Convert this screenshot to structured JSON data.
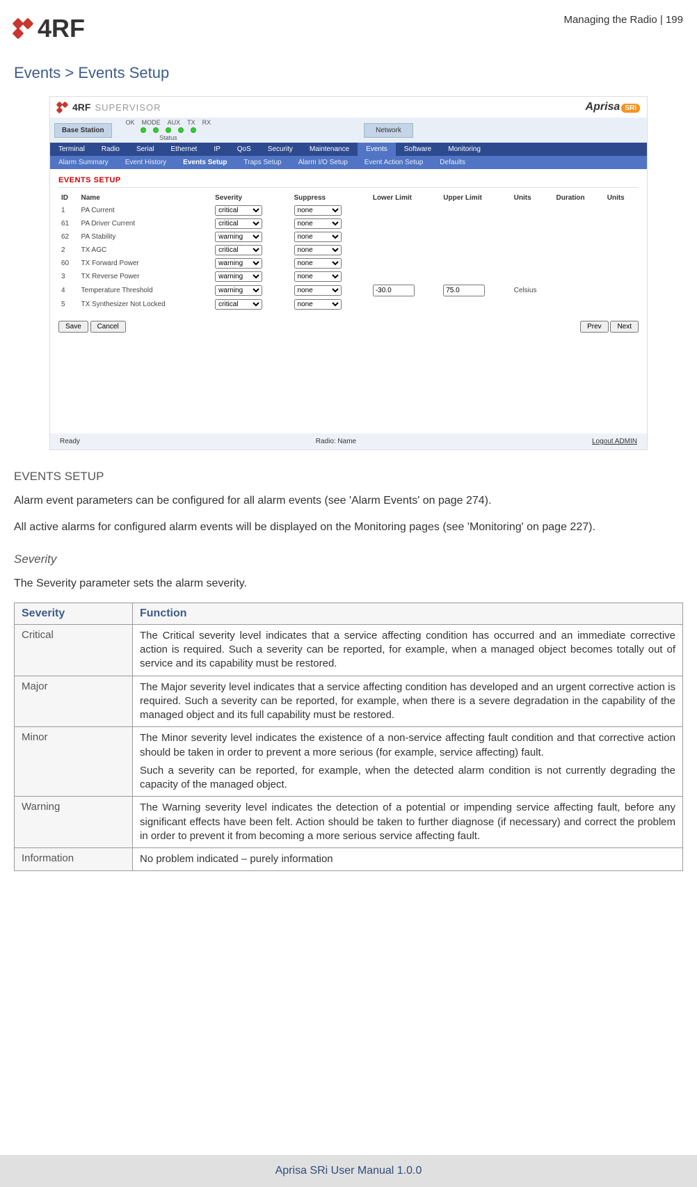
{
  "header": {
    "brand": "4RF",
    "chapter": "Managing the Radio  |  199"
  },
  "breadcrumb": "Events > Events Setup",
  "supervisor": {
    "logo_brand": "4RF",
    "logo_text": "SUPERVISOR",
    "aprisa": "Aprisa",
    "aprisa_badge": "SRi",
    "base_station": "Base Station",
    "led_labels": [
      "OK",
      "MODE",
      "AUX",
      "TX",
      "RX"
    ],
    "status_label": "Status",
    "network_btn": "Network",
    "primary_nav": [
      "Terminal",
      "Radio",
      "Serial",
      "Ethernet",
      "IP",
      "QoS",
      "Security",
      "Maintenance",
      "Events",
      "Software",
      "Monitoring"
    ],
    "primary_active": "Events",
    "sub_nav": [
      "Alarm Summary",
      "Event History",
      "Events Setup",
      "Traps Setup",
      "Alarm I/O Setup",
      "Event Action Setup",
      "Defaults"
    ],
    "sub_active": "Events Setup",
    "panel_title": "EVENTS SETUP",
    "columns": [
      "ID",
      "Name",
      "Severity",
      "Suppress",
      "Lower Limit",
      "Upper Limit",
      "Units",
      "Duration",
      "Units"
    ],
    "rows": [
      {
        "id": "1",
        "name": "PA Current",
        "severity": "critical",
        "suppress": "none",
        "ll": "",
        "ul": "",
        "units": "",
        "dur": "",
        "u2": ""
      },
      {
        "id": "61",
        "name": "PA Driver Current",
        "severity": "critical",
        "suppress": "none",
        "ll": "",
        "ul": "",
        "units": "",
        "dur": "",
        "u2": ""
      },
      {
        "id": "62",
        "name": "PA Stability",
        "severity": "warning",
        "suppress": "none",
        "ll": "",
        "ul": "",
        "units": "",
        "dur": "",
        "u2": ""
      },
      {
        "id": "2",
        "name": "TX AGC",
        "severity": "critical",
        "suppress": "none",
        "ll": "",
        "ul": "",
        "units": "",
        "dur": "",
        "u2": ""
      },
      {
        "id": "60",
        "name": "TX Forward Power",
        "severity": "warning",
        "suppress": "none",
        "ll": "",
        "ul": "",
        "units": "",
        "dur": "",
        "u2": ""
      },
      {
        "id": "3",
        "name": "TX Reverse Power",
        "severity": "warning",
        "suppress": "none",
        "ll": "",
        "ul": "",
        "units": "",
        "dur": "",
        "u2": ""
      },
      {
        "id": "4",
        "name": "Temperature Threshold",
        "severity": "warning",
        "suppress": "none",
        "ll": "-30.0",
        "ul": "75.0",
        "units": "Celsius",
        "dur": "",
        "u2": ""
      },
      {
        "id": "5",
        "name": "TX Synthesizer Not Locked",
        "severity": "critical",
        "suppress": "none",
        "ll": "",
        "ul": "",
        "units": "",
        "dur": "",
        "u2": ""
      }
    ],
    "buttons": {
      "save": "Save",
      "cancel": "Cancel",
      "prev": "Prev",
      "next": "Next"
    },
    "footer": {
      "ready": "Ready",
      "radio": "Radio: Name",
      "logout": "Logout ADMIN"
    }
  },
  "section": {
    "setup_head": "EVENTS SETUP",
    "p1": "Alarm event parameters can be configured for all alarm events (see 'Alarm Events' on page 274).",
    "p2": "All active alarms for configured alarm events will be displayed on the Monitoring pages (see 'Monitoring' on page 227).",
    "severity_head": "Severity",
    "severity_intro": "The Severity parameter sets the alarm severity."
  },
  "table": {
    "h1": "Severity",
    "h2": "Function",
    "rows": [
      {
        "label": "Critical",
        "desc": "The Critical severity level indicates that a service affecting condition has occurred and an immediate corrective action is required. Such a severity can be reported, for example, when a managed object becomes totally out of service and its capability must be restored."
      },
      {
        "label": "Major",
        "desc": "The Major severity level indicates that a service affecting condition has developed and an urgent corrective action is required. Such a severity can be reported, for example, when there is a severe degradation in the capability of the managed object and its full capability must be restored."
      },
      {
        "label": "Minor",
        "desc": "The Minor severity level indicates the existence of a non-service affecting fault condition and that corrective action should be taken in order to prevent a more serious (for example, service affecting) fault.",
        "desc2": "Such a severity can be reported, for example, when the detected alarm condition is not currently degrading the capacity of the managed object."
      },
      {
        "label": "Warning",
        "desc": "The Warning severity level indicates the detection of a potential or impending service affecting fault, before any significant effects have been felt. Action should be taken to further diagnose (if necessary) and correct the problem in order to prevent it from becoming a more serious service affecting fault."
      },
      {
        "label": "Information",
        "desc": "No problem indicated – purely information"
      }
    ]
  },
  "footer_text": "Aprisa SRi User Manual 1.0.0"
}
